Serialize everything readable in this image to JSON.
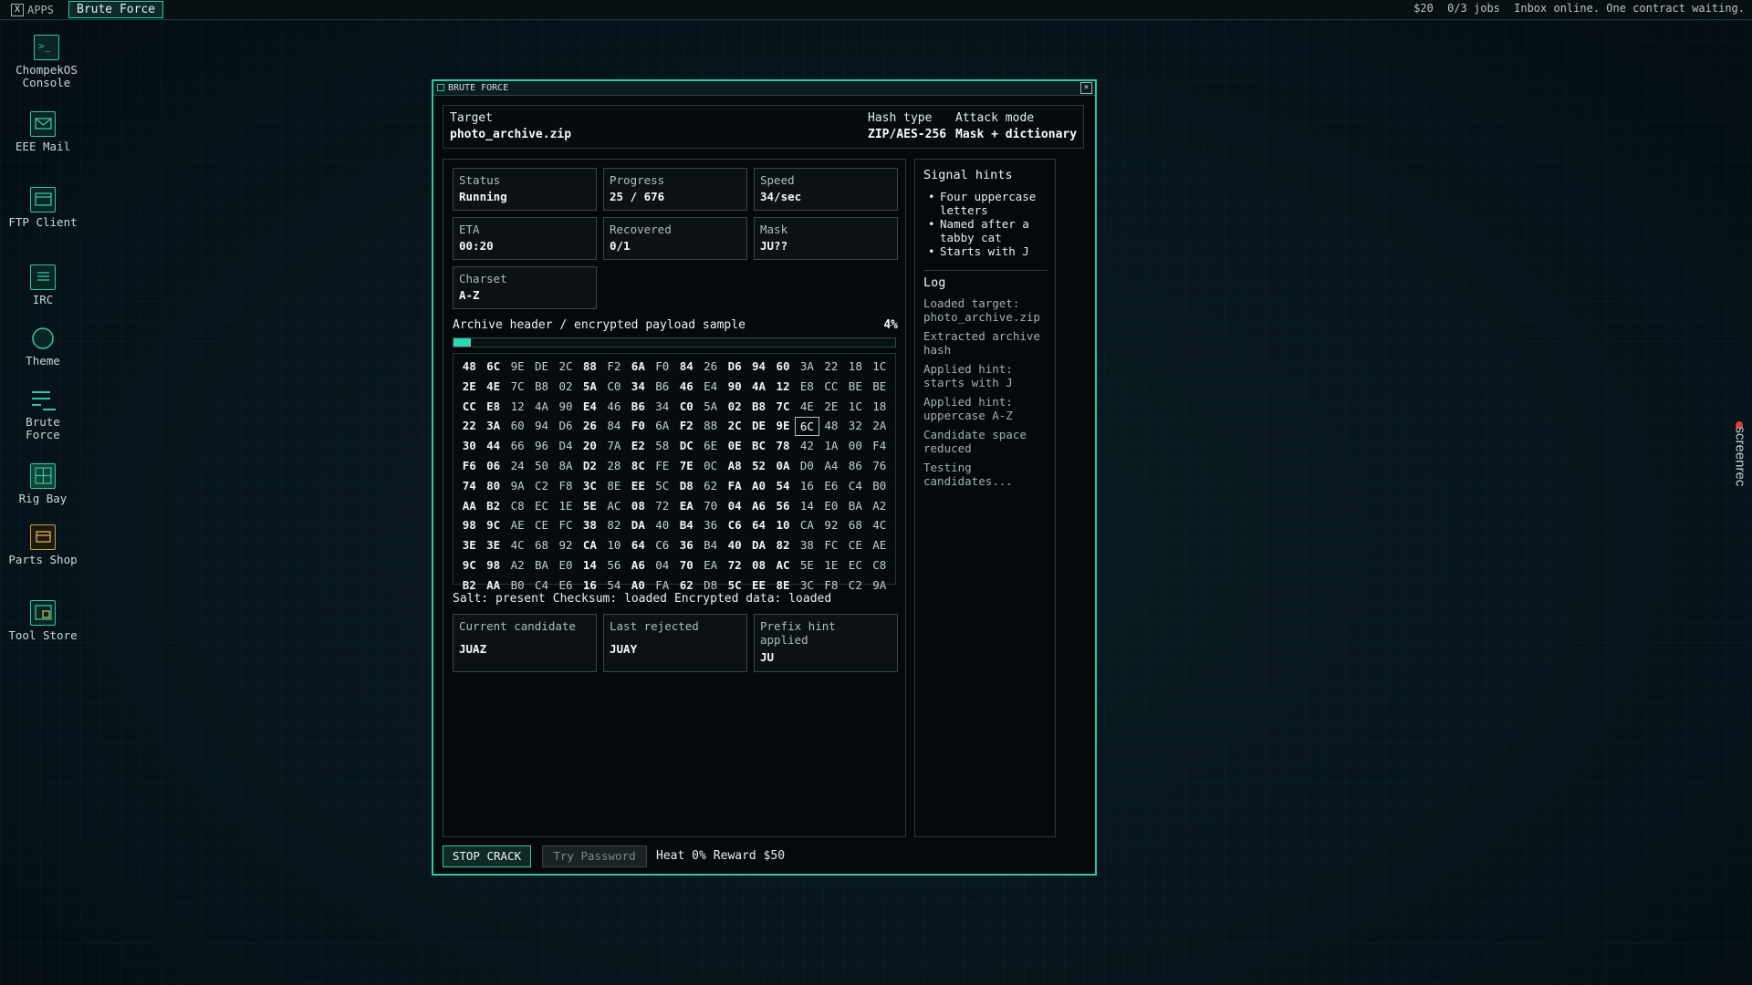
{
  "topbar": {
    "apps_label": "APPS",
    "active_task": "Brute Force",
    "money": "$20",
    "jobs": "0/3 jobs",
    "message": "Inbox online. One contract waiting."
  },
  "desktop": {
    "icons": [
      {
        "label": "ChompekOS Console",
        "icon": "terminal-icon"
      },
      {
        "label": "EEE Mail",
        "icon": "mail-icon"
      },
      {
        "label": "FTP Client",
        "icon": "ftp-icon"
      },
      {
        "label": "IRC",
        "icon": "chat-icon"
      },
      {
        "label": "Theme",
        "icon": "theme-icon"
      },
      {
        "label": "Brute Force",
        "icon": "brute-force-icon"
      },
      {
        "label": "Rig Bay",
        "icon": "rig-icon"
      },
      {
        "label": "Parts Shop",
        "icon": "shop-icon"
      },
      {
        "label": "Tool Store",
        "icon": "store-icon"
      }
    ]
  },
  "window": {
    "title": "BRUTE FORCE",
    "target_label": "Target",
    "target_value": "photo_archive.zip",
    "hash_label": "Hash type",
    "hash_value": "ZIP/AES-256",
    "attack_label": "Attack mode",
    "attack_value": "Mask + dictionary",
    "stats": [
      {
        "label": "Status",
        "value": "Running"
      },
      {
        "label": "Progress",
        "value": "25 / 676"
      },
      {
        "label": "Speed",
        "value": "34/sec"
      },
      {
        "label": "ETA",
        "value": "00:20"
      },
      {
        "label": "Recovered",
        "value": "0/1"
      },
      {
        "label": "Mask",
        "value": "JU??"
      },
      {
        "label": "Charset",
        "value": "A-Z"
      }
    ],
    "sample_label": "Archive header / encrypted payload sample",
    "sample_percent": "4%",
    "progress_fraction": 0.04,
    "hex_bytes": [
      "48",
      "6C",
      "9E",
      "DE",
      "2C",
      "88",
      "F2",
      "6A",
      "F0",
      "84",
      "26",
      "D6",
      "94",
      "60",
      "3A",
      "22",
      "18",
      "1C",
      "2E",
      "4E",
      "7C",
      "B8",
      "02",
      "5A",
      "C0",
      "34",
      "B6",
      "46",
      "E4",
      "90",
      "4A",
      "12",
      "E8",
      "CC",
      "BE",
      "BE",
      "CC",
      "E8",
      "12",
      "4A",
      "90",
      "E4",
      "46",
      "B6",
      "34",
      "C0",
      "5A",
      "02",
      "B8",
      "7C",
      "4E",
      "2E",
      "1C",
      "18",
      "22",
      "3A",
      "60",
      "94",
      "D6",
      "26",
      "84",
      "F0",
      "6A",
      "F2",
      "88",
      "2C",
      "DE",
      "9E",
      "6C",
      "48",
      "32",
      "2A",
      "30",
      "44",
      "66",
      "96",
      "D4",
      "20",
      "7A",
      "E2",
      "58",
      "DC",
      "6E",
      "0E",
      "BC",
      "78",
      "42",
      "1A",
      "00",
      "F4",
      "F6",
      "06",
      "24",
      "50",
      "8A",
      "D2",
      "28",
      "8C",
      "FE",
      "7E",
      "0C",
      "A8",
      "52",
      "0A",
      "D0",
      "A4",
      "86",
      "76",
      "74",
      "80",
      "9A",
      "C2",
      "F8",
      "3C",
      "8E",
      "EE",
      "5C",
      "D8",
      "62",
      "FA",
      "A0",
      "54",
      "16",
      "E6",
      "C4",
      "B0",
      "AA",
      "B2",
      "C8",
      "EC",
      "1E",
      "5E",
      "AC",
      "08",
      "72",
      "EA",
      "70",
      "04",
      "A6",
      "56",
      "14",
      "E0",
      "BA",
      "A2",
      "98",
      "9C",
      "AE",
      "CE",
      "FC",
      "38",
      "82",
      "DA",
      "40",
      "B4",
      "36",
      "C6",
      "64",
      "10",
      "CA",
      "92",
      "68",
      "4C",
      "3E",
      "3E",
      "4C",
      "68",
      "92",
      "CA",
      "10",
      "64",
      "C6",
      "36",
      "B4",
      "40",
      "DA",
      "82",
      "38",
      "FC",
      "CE",
      "AE",
      "9C",
      "98",
      "A2",
      "BA",
      "E0",
      "14",
      "56",
      "A6",
      "04",
      "70",
      "EA",
      "72",
      "08",
      "AC",
      "5E",
      "1E",
      "EC",
      "C8",
      "B2",
      "AA",
      "B0",
      "C4",
      "E6",
      "16",
      "54",
      "A0",
      "FA",
      "62",
      "D8",
      "5C",
      "EE",
      "8E",
      "3C",
      "F8",
      "C2",
      "9A"
    ],
    "meta": [
      "Salt: present",
      "Checksum: loaded",
      "Encrypted data: loaded"
    ],
    "candidates": [
      {
        "label": "Current candidate",
        "value": "JUAZ"
      },
      {
        "label": "Last rejected",
        "value": "JUAY"
      },
      {
        "label": "Prefix hint applied",
        "value": "JU"
      }
    ],
    "hints_title": "Signal hints",
    "hints": [
      "Four uppercase letters",
      "Named after a tabby cat",
      "Starts with J"
    ],
    "log_title": "Log",
    "log": [
      "Loaded target: photo_archive.zip",
      "Extracted archive hash",
      "Applied hint: starts with J",
      "Applied hint: uppercase A-Z",
      "Candidate space reduced",
      "Testing candidates..."
    ],
    "stop_label": "STOP CRACK",
    "try_label": "Try Password",
    "heat": "Heat 0%",
    "reward": "Reward $50"
  },
  "watermark": {
    "text": "screenrec"
  },
  "colors": {
    "accent": "#2fc7a6",
    "background": "#07151a",
    "record_dot": "#e23b3b"
  }
}
